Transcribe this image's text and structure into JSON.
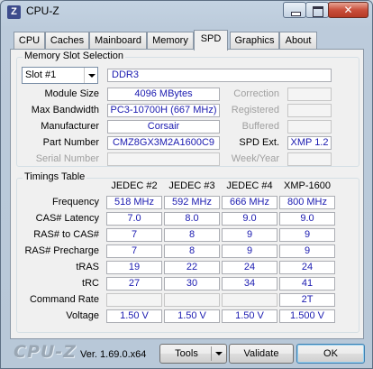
{
  "window": {
    "title": "CPU-Z",
    "icon_letter": "Z"
  },
  "tabs": [
    "CPU",
    "Caches",
    "Mainboard",
    "Memory",
    "SPD",
    "Graphics",
    "About"
  ],
  "active_tab": "SPD",
  "slot_section": {
    "legend": "Memory Slot Selection",
    "slot_value": "Slot #1",
    "memory_type": "DDR3",
    "labels": {
      "module_size": "Module Size",
      "max_bandwidth": "Max Bandwidth",
      "manufacturer": "Manufacturer",
      "part_number": "Part Number",
      "serial_number": "Serial Number",
      "correction": "Correction",
      "registered": "Registered",
      "buffered": "Buffered",
      "spd_ext": "SPD Ext.",
      "week_year": "Week/Year"
    },
    "values": {
      "module_size": "4096 MBytes",
      "max_bandwidth": "PC3-10700H (667 MHz)",
      "manufacturer": "Corsair",
      "part_number": "CMZ8GX3M2A1600C9",
      "serial_number": "",
      "correction": "",
      "registered": "",
      "buffered": "",
      "spd_ext": "XMP 1.2",
      "week_year": ""
    }
  },
  "timings": {
    "legend": "Timings Table",
    "columns": [
      "JEDEC #2",
      "JEDEC #3",
      "JEDEC #4",
      "XMP-1600"
    ],
    "rows": [
      {
        "label": "Frequency",
        "values": [
          "518 MHz",
          "592 MHz",
          "666 MHz",
          "800 MHz"
        ]
      },
      {
        "label": "CAS# Latency",
        "values": [
          "7.0",
          "8.0",
          "9.0",
          "9.0"
        ]
      },
      {
        "label": "RAS# to CAS#",
        "values": [
          "7",
          "8",
          "9",
          "9"
        ]
      },
      {
        "label": "RAS# Precharge",
        "values": [
          "7",
          "8",
          "9",
          "9"
        ]
      },
      {
        "label": "tRAS",
        "values": [
          "19",
          "22",
          "24",
          "24"
        ]
      },
      {
        "label": "tRC",
        "values": [
          "27",
          "30",
          "34",
          "41"
        ]
      },
      {
        "label": "Command Rate",
        "values": [
          "",
          "",
          "",
          "2T"
        ]
      },
      {
        "label": "Voltage",
        "values": [
          "1.50 V",
          "1.50 V",
          "1.50 V",
          "1.500 V"
        ]
      }
    ]
  },
  "footer": {
    "logo": "CPU-Z",
    "version": "Ver. 1.69.0.x64",
    "tools_label": "Tools",
    "validate_label": "Validate",
    "ok_label": "OK"
  },
  "colors": {
    "value_text": "#1a1ab0",
    "panel_bg": "#f0f0f0",
    "frame_bg": "#c4d3e2"
  }
}
